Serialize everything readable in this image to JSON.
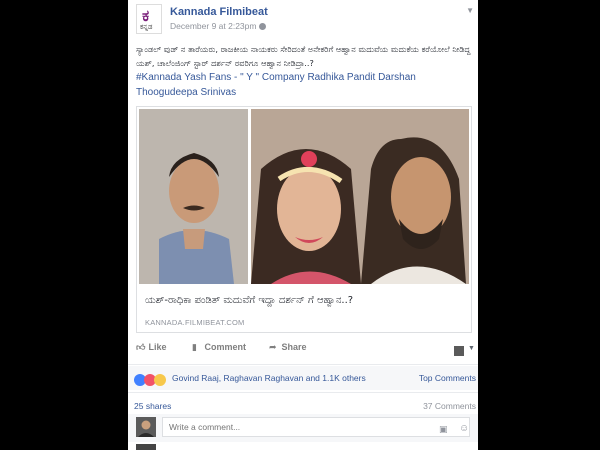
{
  "post": {
    "page_name": "Kannada Filmibeat",
    "time": "December 9 at 2:23pm",
    "logo_text": "ಕ",
    "logo_sub": "ಕನ್ನಡ",
    "text": "ಸ್ಯಾಂಡಲ್ ವುಡ್ ನ ತಾರೆಯರು, ರಾಜಕೀಯ ನಾಯಕರು ಸೇರಿದಂತೆ ಅನೇಕರಿಗೆ ಆಹ್ವಾನ ಮದುವೆಯ ಮದುಕೆಯ ಕರೆಯೋಲೆ ನೀಡಿದ್ದ ಯಶ್, ಚಾಲೆಂಜಿಂಗ್ ಸ್ಟಾರ್ ದರ್ಶನ್ ರವರಿಗೂ ಆಹ್ವಾನ ನೀಡಿದ್ರಾ..?",
    "hashtags": "#Kannada Yash Fans - \" Y \" Company Radhika Pandit Darshan Thoogudeepa Srinivas"
  },
  "preview": {
    "headline": "ಯಶ್-ರಾಧಿಕಾ ಪಂಡಿತ್ ಮದುವೆಗೆ ಇದ್ದಾ ದರ್ಶನ್ ಗೆ ಆಹ್ವಾನ..?",
    "domain": "KANNADA.FILMIBEAT.COM"
  },
  "actions": {
    "like": "Like",
    "comment": "Comment",
    "share": "Share"
  },
  "reactions": {
    "summary": "Govind Raaj, Raghavan Raghavan and 1.1K others",
    "sort_label": "Top Comments",
    "shares": "25 shares",
    "comments": "37 Comments"
  },
  "comment_box": {
    "placeholder": "Write a comment..."
  },
  "colors": {
    "link": "#365899",
    "muted": "#90949c",
    "like": "#4080ff",
    "heart": "#f25268",
    "wow": "#f7c84b"
  }
}
